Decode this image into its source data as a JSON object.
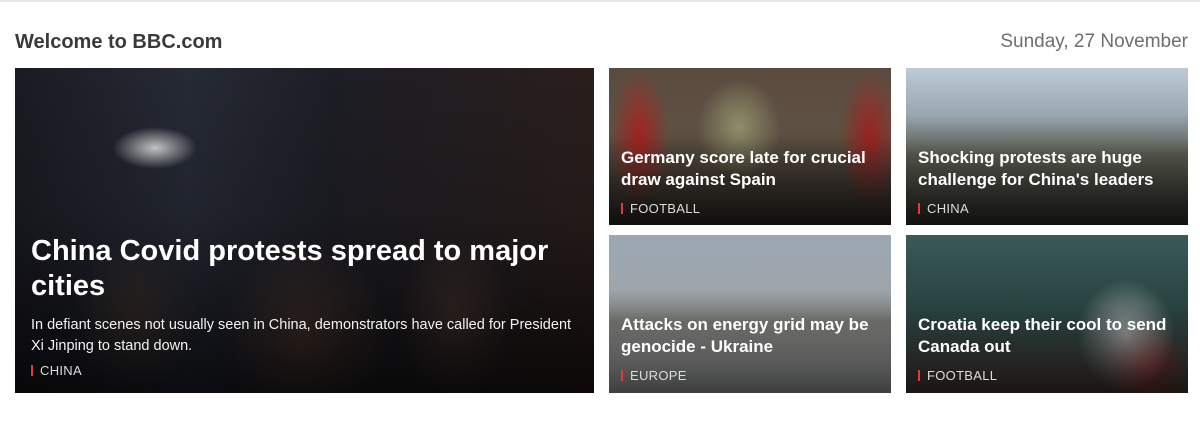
{
  "header": {
    "welcome": "Welcome to BBC.com",
    "date": "Sunday, 27 November"
  },
  "stories": {
    "main": {
      "headline": "China Covid protests spread to major cities",
      "summary": "In defiant scenes not usually seen in China, demonstrators have called for President Xi Jinping to stand down.",
      "tag": "CHINA"
    },
    "germany": {
      "headline": "Germany score late for crucial draw against Spain",
      "tag": "FOOTBALL"
    },
    "china_protests": {
      "headline": "Shocking protests are huge challenge for China's leaders",
      "tag": "CHINA"
    },
    "ukraine": {
      "headline": "Attacks on energy grid may be genocide - Ukraine",
      "tag": "EUROPE"
    },
    "croatia": {
      "headline": "Croatia keep their cool to send Canada out",
      "tag": "FOOTBALL"
    }
  },
  "colors": {
    "tag_marker": "#e03a3a",
    "heading_text": "#3a3a3a",
    "date_text": "#6e6e6e"
  }
}
